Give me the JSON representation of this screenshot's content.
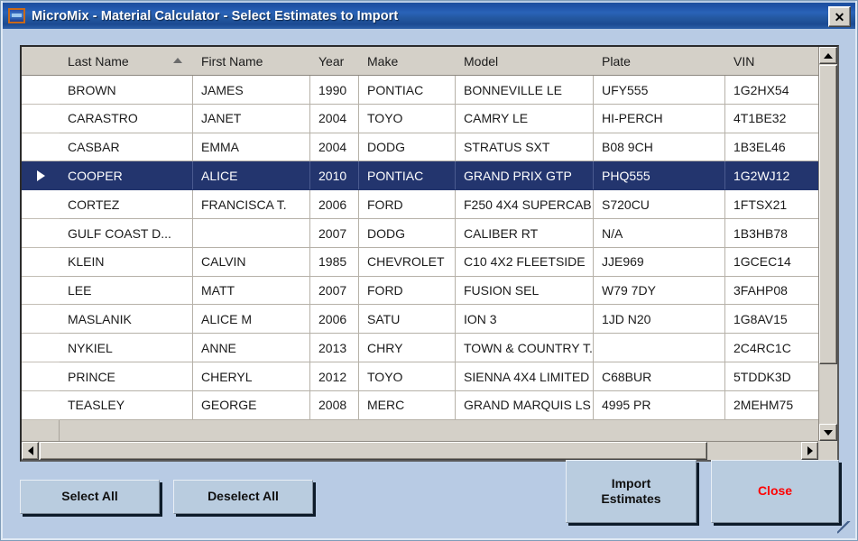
{
  "window": {
    "title": "MicroMix - Material Calculator - Select Estimates to Import",
    "icon": "app-icon",
    "close_label": "✕"
  },
  "grid": {
    "columns": [
      {
        "key": "last_name",
        "label": "Last Name",
        "sorted": "asc"
      },
      {
        "key": "first_name",
        "label": "First Name",
        "sorted": ""
      },
      {
        "key": "year",
        "label": "Year",
        "sorted": ""
      },
      {
        "key": "make",
        "label": "Make",
        "sorted": ""
      },
      {
        "key": "model",
        "label": "Model",
        "sorted": ""
      },
      {
        "key": "plate",
        "label": "Plate",
        "sorted": ""
      },
      {
        "key": "vin",
        "label": "VIN",
        "sorted": ""
      }
    ],
    "rows": [
      {
        "last_name": "BROWN",
        "first_name": "JAMES",
        "year": "1990",
        "make": "PONTIAC",
        "model": "BONNEVILLE LE",
        "plate": "UFY555",
        "vin": "1G2HX54",
        "selected": false
      },
      {
        "last_name": "CARASTRO",
        "first_name": "JANET",
        "year": "2004",
        "make": "TOYO",
        "model": "CAMRY LE",
        "plate": "HI-PERCH",
        "vin": "4T1BE32",
        "selected": false
      },
      {
        "last_name": "CASBAR",
        "first_name": "EMMA",
        "year": "2004",
        "make": "DODG",
        "model": "STRATUS SXT",
        "plate": "B08 9CH",
        "vin": "1B3EL46",
        "selected": false
      },
      {
        "last_name": "COOPER",
        "first_name": "ALICE",
        "year": "2010",
        "make": "PONTIAC",
        "model": "GRAND PRIX GTP",
        "plate": "PHQ555",
        "vin": "1G2WJ12",
        "selected": true
      },
      {
        "last_name": "CORTEZ",
        "first_name": "FRANCISCA T.",
        "year": "2006",
        "make": "FORD",
        "model": "F250 4X4 SUPERCAB",
        "plate": "S720CU",
        "vin": "1FTSX21",
        "selected": false
      },
      {
        "last_name": "GULF COAST D...",
        "first_name": "",
        "year": "2007",
        "make": "DODG",
        "model": "CALIBER RT",
        "plate": "N/A",
        "vin": "1B3HB78",
        "selected": false
      },
      {
        "last_name": "KLEIN",
        "first_name": "CALVIN",
        "year": "1985",
        "make": "CHEVROLET",
        "model": "C10 4X2 FLEETSIDE",
        "plate": "JJE969",
        "vin": "1GCEC14",
        "selected": false
      },
      {
        "last_name": "LEE",
        "first_name": "MATT",
        "year": "2007",
        "make": "FORD",
        "model": "FUSION SEL",
        "plate": "W79 7DY",
        "vin": "3FAHP08",
        "selected": false
      },
      {
        "last_name": "MASLANIK",
        "first_name": "ALICE M",
        "year": "2006",
        "make": "SATU",
        "model": "ION 3",
        "plate": "1JD N20",
        "vin": "1G8AV15",
        "selected": false
      },
      {
        "last_name": "NYKIEL",
        "first_name": "ANNE",
        "year": "2013",
        "make": "CHRY",
        "model": "TOWN & COUNTRY T...",
        "plate": "",
        "vin": "2C4RC1C",
        "selected": false
      },
      {
        "last_name": "PRINCE",
        "first_name": "CHERYL",
        "year": "2012",
        "make": "TOYO",
        "model": "SIENNA 4X4 LIMITED",
        "plate": "C68BUR",
        "vin": "5TDDK3D",
        "selected": false
      },
      {
        "last_name": "TEASLEY",
        "first_name": "GEORGE",
        "year": "2008",
        "make": "MERC",
        "model": "GRAND MARQUIS LS",
        "plate": "4995 PR",
        "vin": "2MEHM75",
        "selected": false
      }
    ]
  },
  "scrollbars": {
    "vertical": {
      "up_icon": "triangle-up-icon",
      "down_icon": "triangle-down-icon"
    },
    "horizontal": {
      "left_icon": "triangle-left-icon",
      "right_icon": "triangle-right-icon"
    }
  },
  "buttons": {
    "select_all": "Select All",
    "deselect_all": "Deselect All",
    "import_estimates": "Import\nEstimates",
    "import_estimates_line1": "Import",
    "import_estimates_line2": "Estimates",
    "close": "Close"
  },
  "colors": {
    "title_bar": "#1e52a6",
    "selection": "#23356e",
    "header_bg": "#d4d0c8",
    "dialog_bg": "#b8cbe4",
    "button_face": "#b9ccdf",
    "close_text": "#ff0000"
  }
}
